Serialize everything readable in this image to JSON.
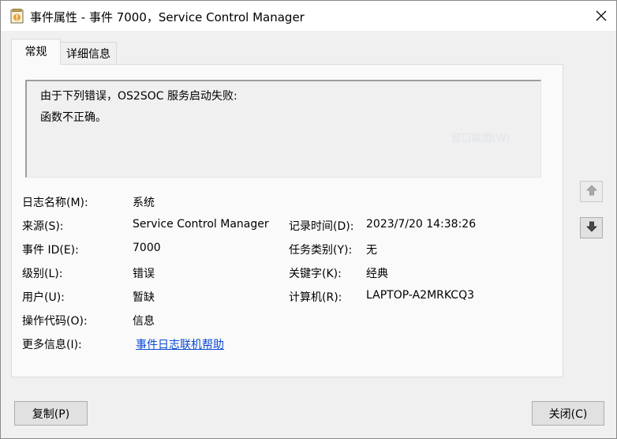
{
  "window": {
    "title": "事件属性 - 事件 7000，Service Control Manager",
    "app_icon": "event-viewer-icon",
    "close_icon": "close-icon"
  },
  "tabs": [
    {
      "label": "常规",
      "selected": true
    },
    {
      "label": "详细信息",
      "selected": false
    }
  ],
  "description": {
    "line1": "由于下列错误，OS2SOC 服务启动失败:",
    "line2": "函数不正确。",
    "ghost": "窗口截图(W)"
  },
  "fields": {
    "log_name": {
      "label": "日志名称(M):",
      "value": "系统"
    },
    "source": {
      "label": "来源(S):",
      "value": "Service Control Manager"
    },
    "logged": {
      "label": "记录时间(D):",
      "value": "2023/7/20 14:38:26"
    },
    "event_id": {
      "label": "事件 ID(E):",
      "value": "7000"
    },
    "task_category": {
      "label": "任务类别(Y):",
      "value": "无"
    },
    "level": {
      "label": "级别(L):",
      "value": "错误"
    },
    "keywords": {
      "label": "关键字(K):",
      "value": "经典"
    },
    "user": {
      "label": "用户(U):",
      "value": "暂缺"
    },
    "computer": {
      "label": "计算机(R):",
      "value": "LAPTOP-A2MRKCQ3"
    },
    "opcode": {
      "label": "操作代码(O):",
      "value": "信息"
    },
    "more_info": {
      "label": "更多信息(I):",
      "link": "事件日志联机帮助"
    }
  },
  "side_buttons": {
    "up_icon": "arrow-up-icon",
    "down_icon": "arrow-down-icon"
  },
  "buttons": {
    "copy": "复制(P)",
    "close": "关闭(C)"
  }
}
